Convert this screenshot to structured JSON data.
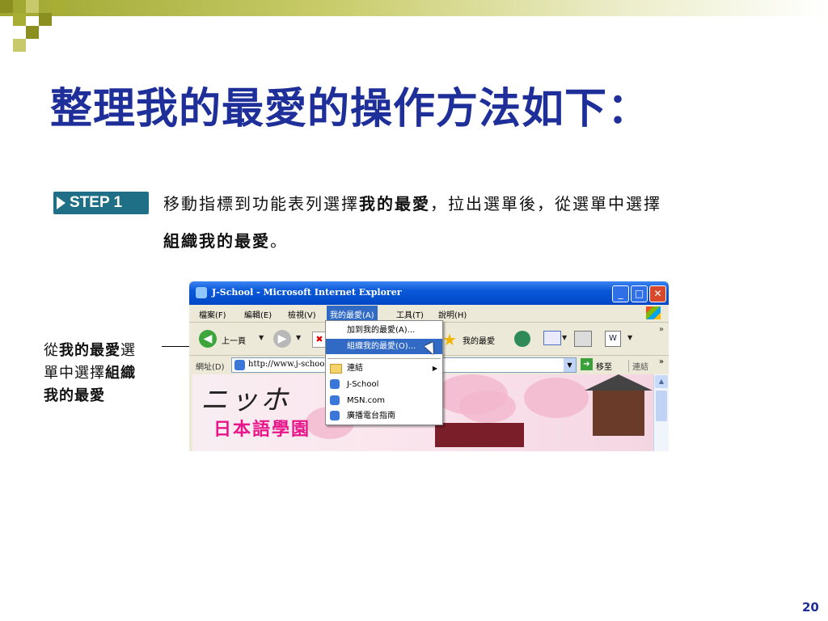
{
  "slide": {
    "title": "整理我的最愛的操作方法如下：",
    "step_label": "STEP 1",
    "step_text_1": "移動指標到功能表列選擇",
    "step_text_bold_1": "我的最愛",
    "step_text_2": "，拉出選單後，從選單中選擇",
    "step_text_bold_2": "組織我的最愛",
    "step_text_3": "。",
    "callout_1": "從",
    "callout_bold_1": "我的最愛",
    "callout_2": "選",
    "callout_3": "單中選擇",
    "callout_bold_2": "組織",
    "callout_bold_3": "我的最愛",
    "page_number": "20"
  },
  "browser": {
    "title": "J-School - Microsoft Internet Explorer",
    "menus": [
      "檔案(F)",
      "編輯(E)",
      "檢視(V)",
      "我的最愛(A)",
      "工具(T)",
      "說明(H)"
    ],
    "back_label": "上一頁",
    "favorites_label": "我的最愛",
    "address_label": "網址(D)",
    "address_value": "http://www.j-school.",
    "go_label": "移至",
    "links_label": "連結",
    "logo_text": "日本語學園",
    "logo_script": "ニッホ",
    "dropdown_items": [
      {
        "label": "加到我的最愛(A)..."
      },
      {
        "label": "組織我的最愛(O)..."
      },
      {
        "label": "連結"
      },
      {
        "label": "J-School"
      },
      {
        "label": "MSN.com"
      },
      {
        "label": "廣播電台指南"
      }
    ]
  },
  "colors": {
    "title": "#1f2f9a",
    "step_badge": "#1f6f86",
    "menu_highlight": "#316ac5",
    "logo_pink": "#e8168a"
  }
}
